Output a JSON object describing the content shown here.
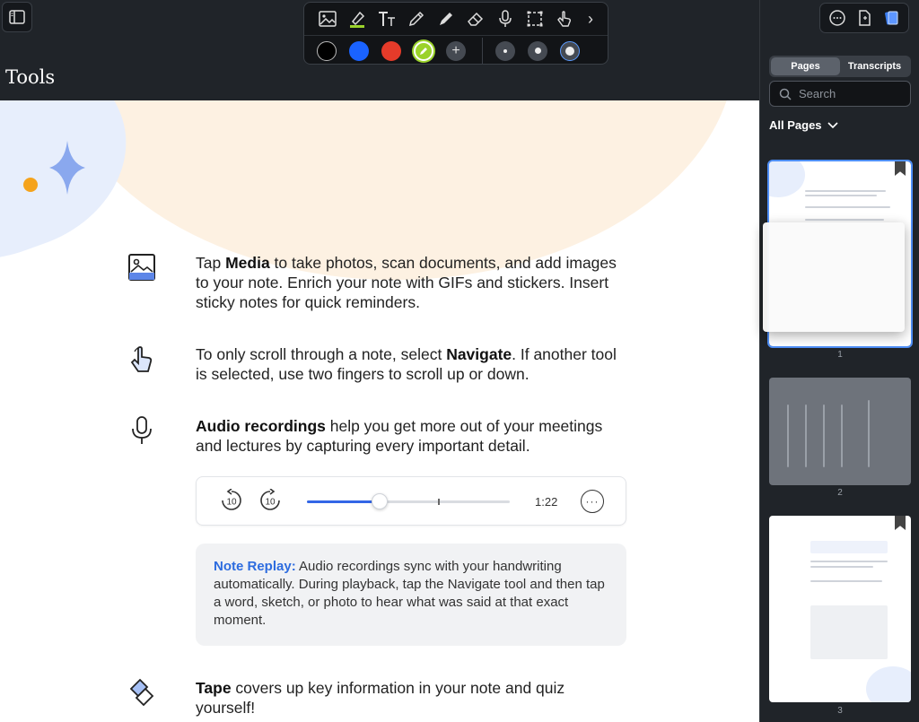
{
  "header": {
    "page_title": "Tools",
    "sidebar_toggle_icon": "sidebar-icon"
  },
  "toolbar": {
    "tools": [
      "media-icon",
      "highlighter-icon",
      "text-icon",
      "pencil-icon",
      "marker-icon",
      "eraser-icon",
      "microphone-icon",
      "lasso-icon",
      "navigate-icon",
      "chevron-right-icon"
    ],
    "more_label": "›",
    "colors": [
      "#000000",
      "#1a63ff",
      "#e53b2a",
      "#9bd22b"
    ],
    "add_color_label": "+",
    "active_color": "#9bd22b"
  },
  "content": {
    "media": {
      "prefix": "Tap ",
      "bold": "Media",
      "rest": " to take photos, scan documents, and add images to your note. Enrich your note with GIFs and stickers. Insert sticky notes for quick reminders."
    },
    "navigate": {
      "prefix": "To only scroll through a note, select ",
      "bold": "Navigate",
      "rest": ". If another tool is selected, use two fingers to scroll up or down."
    },
    "audio": {
      "bold": "Audio recordings",
      "rest": " help you get more out of your meetings and lectures by capturing every important detail."
    },
    "player": {
      "skip_back_label": "10",
      "skip_forward_label": "10",
      "progress": 0.36,
      "time": "1:22",
      "more_label": "···"
    },
    "replay": {
      "lead": "Note Replay:",
      "text": " Audio recordings sync with your handwriting automatically. During playback, tap the Navigate tool and then tap a word, sketch, or photo to hear what was said at that exact moment."
    },
    "tape": {
      "bold": "Tape",
      "rest": " covers up key information in your note and quiz yourself!"
    }
  },
  "panel": {
    "tabs": [
      "Pages",
      "Transcripts"
    ],
    "active_tab": "Pages",
    "search_placeholder": "Search",
    "filter_label": "All Pages",
    "pages": [
      "1",
      "2",
      "3"
    ]
  },
  "colors": {
    "accent": "#2d6cdf",
    "panel_bg": "#202429",
    "selection": "#4f8ff7"
  }
}
